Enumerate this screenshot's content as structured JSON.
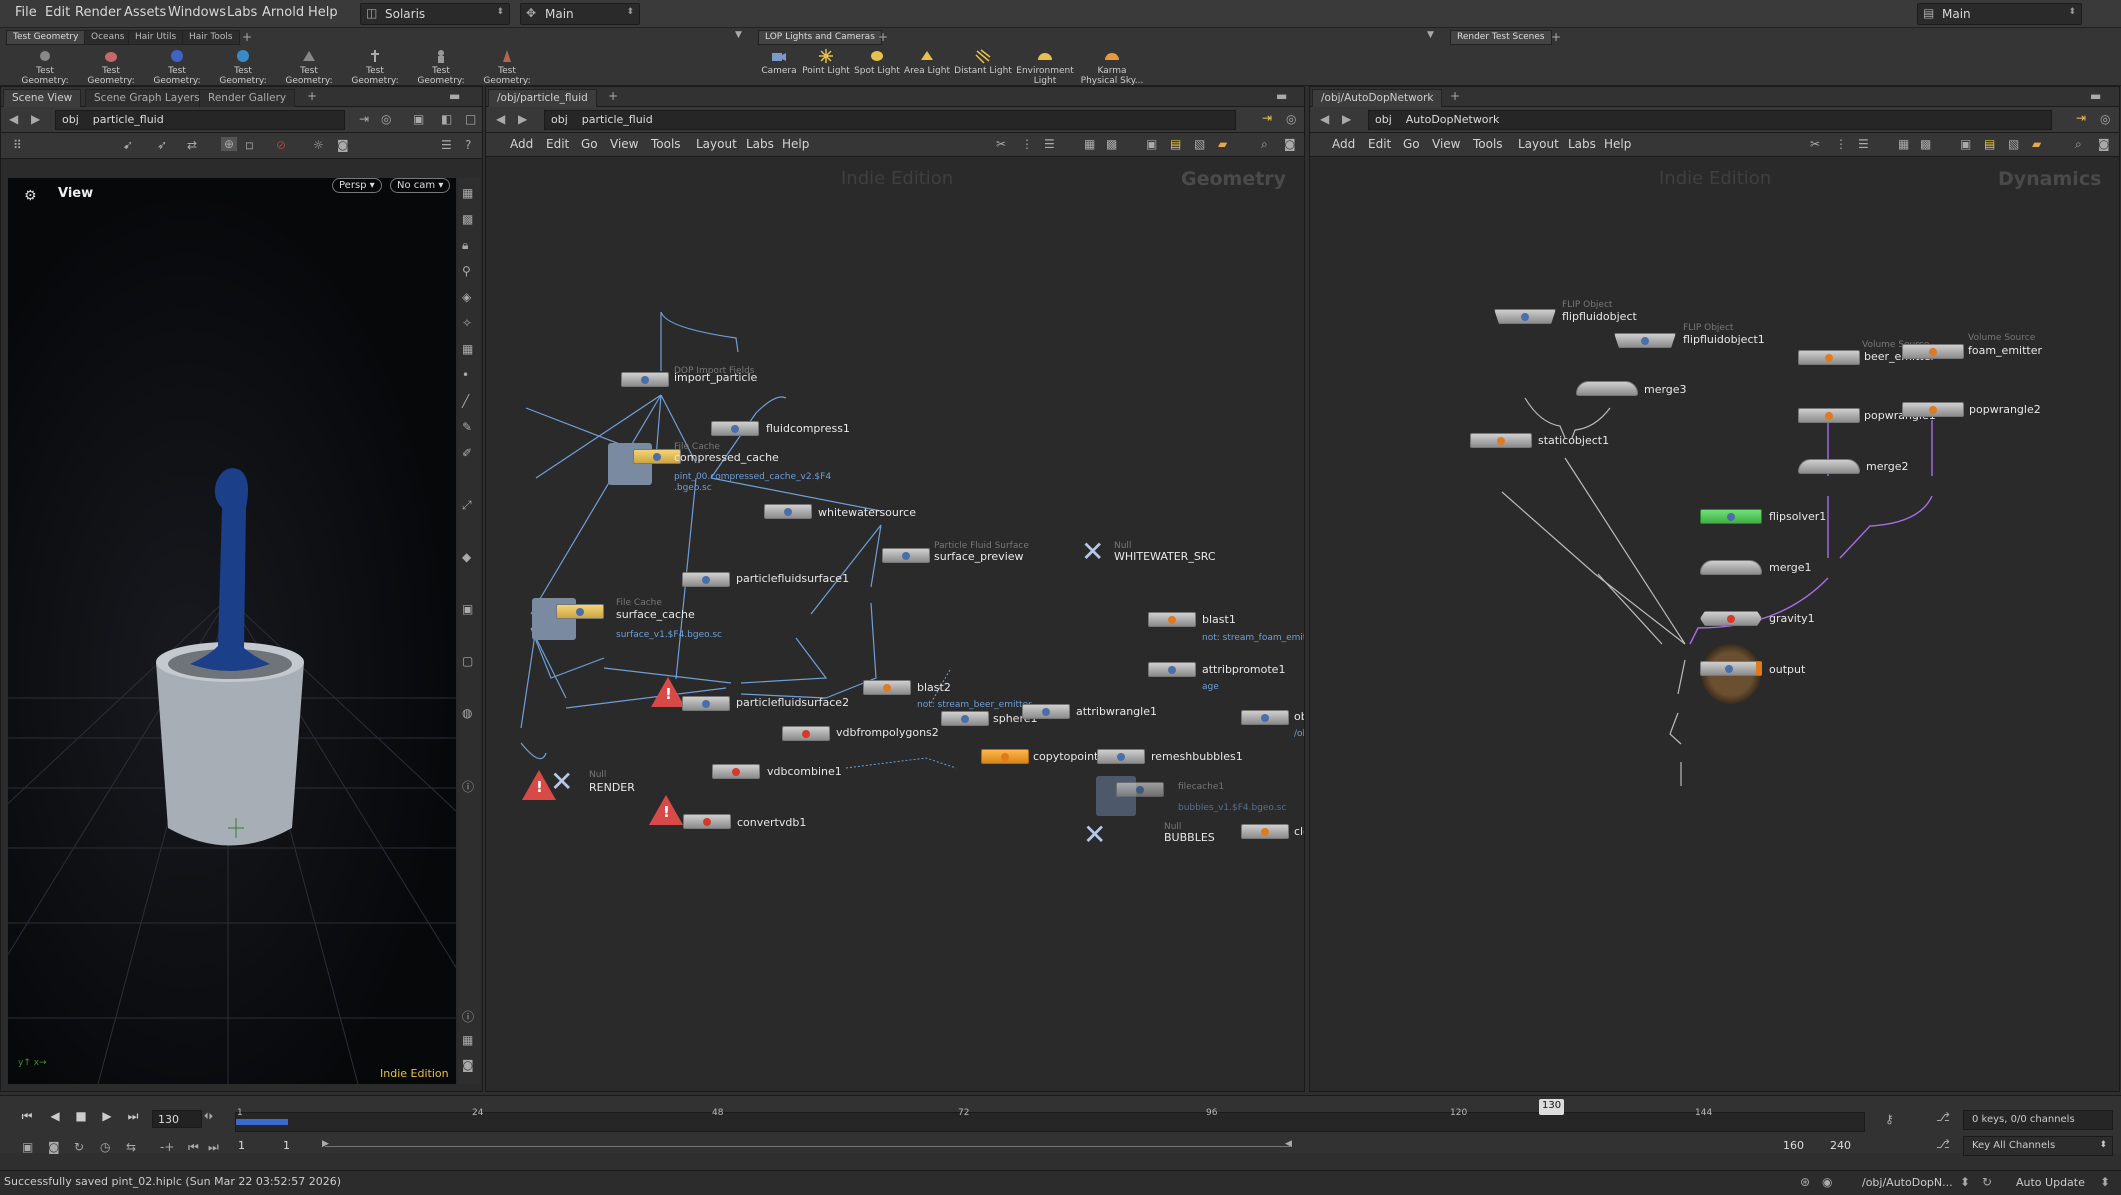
{
  "menubar": {
    "items": [
      "File",
      "Edit",
      "Render",
      "Assets",
      "Windows",
      "Labs",
      "Arnold",
      "Help"
    ],
    "desktop": "Solaris",
    "context": "Main",
    "right_context": "Main"
  },
  "shelf_left": {
    "tabs": [
      "Test Geometry",
      "Oceans",
      "Hair Utils",
      "Hair Tools"
    ],
    "tools": [
      "Test Geometry: C...",
      "Test Geometry: P...",
      "Test Geometry: R...",
      "Test Geometry: S...",
      "Test Geometry: S...",
      "Test Geometry: T...",
      "Test Geometry: T...",
      "Test Geometry: T..."
    ]
  },
  "shelf_mid": {
    "tabs": [
      "LOP Lights and Cameras"
    ],
    "tools": [
      "Camera",
      "Point Light",
      "Spot Light",
      "Area Light",
      "Distant Light",
      "Environment Light",
      "Karma Physical Sky..."
    ]
  },
  "shelf_right": {
    "tabs": [
      "Render Test Scenes"
    ]
  },
  "scene_pane": {
    "tabs": [
      "Scene View",
      "Scene Graph Layers",
      "Render Gallery"
    ],
    "path_root": "obj",
    "path": "particle_fluid",
    "view_label": "View",
    "persp": "Persp",
    "cam": "No cam",
    "edition": "Indie Edition"
  },
  "geo_pane": {
    "tab": "/obj/particle_fluid",
    "path_root": "obj",
    "path": "particle_fluid",
    "menu": [
      "Add",
      "Edit",
      "Go",
      "View",
      "Tools",
      "Layout",
      "Labs",
      "Help"
    ],
    "watermark": "Indie Edition",
    "context": "Geometry",
    "nodes": [
      {
        "id": "import_particle",
        "type": "DOP Import Fields",
        "label": "import_particle"
      },
      {
        "id": "fluidcompress1",
        "label": "fluidcompress1"
      },
      {
        "id": "compressed_cache",
        "type": "File Cache",
        "label": "compressed_cache",
        "sub": "pint_00.compressed_cache_v2.$F4",
        "sub2": ".bgeo.sc"
      },
      {
        "id": "whitewatersource",
        "label": "whitewatersource"
      },
      {
        "id": "surface_preview",
        "type": "Particle Fluid Surface",
        "label": "surface_preview"
      },
      {
        "id": "WHITEWATER_SRC",
        "type": "Null",
        "label": "WHITEWATER_SRC"
      },
      {
        "id": "particlefluidsurface1",
        "label": "particlefluidsurface1"
      },
      {
        "id": "surface_cache",
        "type": "File Cache",
        "label": "surface_cache",
        "sub": "surface_v1.$F4.bgeo.sc"
      },
      {
        "id": "blast1",
        "label": "blast1",
        "sub": "not: stream_foam_emitt"
      },
      {
        "id": "attribpromote1",
        "label": "attribpromote1",
        "sub": "age"
      },
      {
        "id": "blast2",
        "label": "blast2",
        "sub": "not: stream_beer_emitter"
      },
      {
        "id": "particlefluidsurface2",
        "label": "particlefluidsurface2"
      },
      {
        "id": "vdbfrompolygons2",
        "label": "vdbfrompolygons2"
      },
      {
        "id": "sphere1",
        "label": "sphere1"
      },
      {
        "id": "attribwrangle1",
        "label": "attribwrangle1"
      },
      {
        "id": "ob",
        "label": "ob",
        "sub": "/ol"
      },
      {
        "id": "vdbcombine1",
        "label": "vdbcombine1"
      },
      {
        "id": "copytopoints1",
        "label": "copytopoints1"
      },
      {
        "id": "remeshbubbles1",
        "label": "remeshbubbles1"
      },
      {
        "id": "RENDER",
        "type": "Null",
        "label": "RENDER"
      },
      {
        "id": "convertvdb1",
        "label": "convertvdb1"
      },
      {
        "id": "filecache1",
        "type": "filecache1",
        "label": "",
        "sub": "bubbles_v1.$F4.bgeo.sc"
      },
      {
        "id": "BUBBLES",
        "type": "Null",
        "label": "BUBBLES"
      },
      {
        "id": "cle",
        "label": "cle"
      }
    ]
  },
  "dop_pane": {
    "tab": "/obj/AutoDopNetwork",
    "path_root": "obj",
    "path": "AutoDopNetwork",
    "menu": [
      "Add",
      "Edit",
      "Go",
      "View",
      "Tools",
      "Layout",
      "Labs",
      "Help"
    ],
    "watermark": "Indie Edition",
    "context": "Dynamics",
    "nodes": [
      {
        "id": "flipfluidobject",
        "type": "FLIP Object",
        "label": "flipfluidobject"
      },
      {
        "id": "flipfluidobject1",
        "type": "FLIP Object",
        "label": "flipfluidobject1"
      },
      {
        "id": "beer_emitter",
        "type": "Volume Source",
        "label": "beer_emitter"
      },
      {
        "id": "foam_emitter",
        "type": "Volume Source",
        "label": "foam_emitter"
      },
      {
        "id": "merge3",
        "label": "merge3"
      },
      {
        "id": "popwrangle1",
        "label": "popwrangle1"
      },
      {
        "id": "popwrangle2",
        "label": "popwrangle2"
      },
      {
        "id": "staticobject1",
        "label": "staticobject1"
      },
      {
        "id": "merge2",
        "label": "merge2"
      },
      {
        "id": "flipsolver1",
        "label": "flipsolver1"
      },
      {
        "id": "merge1",
        "label": "merge1"
      },
      {
        "id": "gravity1",
        "label": "gravity1"
      },
      {
        "id": "output",
        "label": "output"
      }
    ]
  },
  "timeline": {
    "frame": "130",
    "ticks": [
      "1",
      "24",
      "48",
      "72",
      "96",
      "120",
      "144"
    ],
    "marker": "130",
    "start": "1",
    "start2": "1",
    "end1": "160",
    "end2": "240",
    "keys": "0 keys, 0/0 channels",
    "key_all": "Key All Channels"
  },
  "status": {
    "message": "Successfully saved pint_02.hiplc (Sun Mar 22 03:52:57 2026)",
    "network": "/obj/AutoDopN...",
    "update": "Auto Update"
  },
  "colors": {
    "bg": "#2b2b2b",
    "selected_node": "#ffb64a",
    "solver": "#74e07a",
    "error": "#d84a48",
    "link": "#6f9fd8",
    "pop_link": "#a66ee6"
  }
}
